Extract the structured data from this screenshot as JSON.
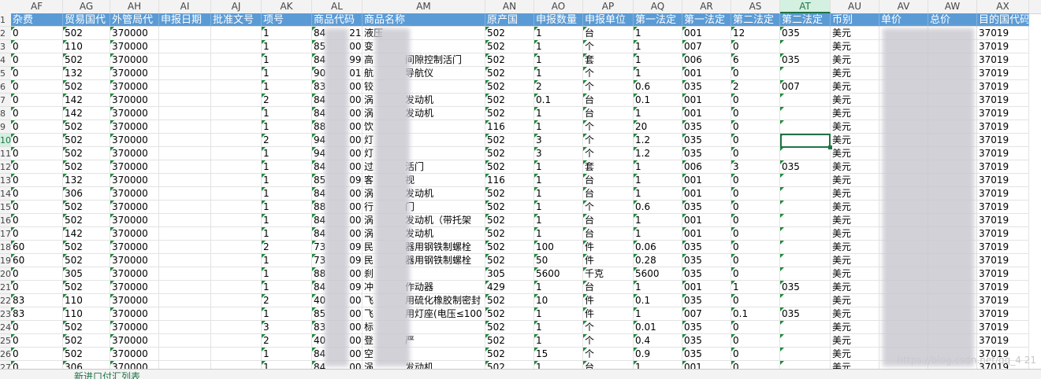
{
  "columns": [
    "AF",
    "AG",
    "AH",
    "AI",
    "AJ",
    "AK",
    "AL",
    "AM",
    "AN",
    "AO",
    "AP",
    "AQ",
    "AR",
    "AS",
    "AT",
    "AU",
    "AV",
    "AW",
    "AX"
  ],
  "active_column": "AT",
  "row_numbers": [
    "1",
    "2",
    "3",
    "4",
    "5",
    "6",
    "7",
    "8",
    "9",
    "10",
    "11",
    "12",
    "13",
    "14",
    "15",
    "16",
    "17",
    "18",
    "19",
    "20",
    "21",
    "22",
    "23",
    "24",
    "25",
    "26",
    "27"
  ],
  "active_row": "10",
  "headers": [
    "杂费",
    "贸易国代",
    "外管局代",
    "申报日期",
    "批准文号",
    "项号",
    "商品代码",
    "商品名称",
    "原产国",
    "申报数量",
    "申报单位",
    "第一法定",
    "第一法定",
    "第二法定",
    "第二法定",
    "币别",
    "单价",
    "总价",
    "目的国代码"
  ],
  "rows": [
    [
      "0",
      "502",
      "370000",
      "",
      "",
      "1",
      "84",
      "219",
      "液压",
      "",
      "502",
      "1",
      "台",
      "1",
      "001",
      "12",
      "035",
      "美元",
      "37019"
    ],
    [
      "0",
      "110",
      "370000",
      "",
      "",
      "1",
      "85",
      "00",
      "变",
      "",
      "502",
      "1",
      "个",
      "1",
      "007",
      "0",
      "",
      "美元",
      "37019"
    ],
    [
      "0",
      "502",
      "370000",
      "",
      "",
      "1",
      "84",
      "99",
      "高",
      "间隙控制活门",
      "502",
      "1",
      "套",
      "1",
      "006",
      "6",
      "035",
      "美元",
      "37019"
    ],
    [
      "0",
      "132",
      "370000",
      "",
      "",
      "1",
      "90",
      "01",
      "航",
      "导航仪",
      "502",
      "1",
      "个",
      "1",
      "001",
      "0",
      "",
      "美元",
      "37019"
    ],
    [
      "0",
      "502",
      "370000",
      "",
      "",
      "1",
      "83",
      "00",
      "铰",
      "",
      "502",
      "2",
      "个",
      "0.6",
      "035",
      "2",
      "007",
      "美元",
      "37019"
    ],
    [
      "0",
      "142",
      "370000",
      "",
      "",
      "2",
      "84",
      "00",
      "涡",
      "发动机",
      "502",
      "0.1",
      "台",
      "0.1",
      "001",
      "0",
      "",
      "美元",
      "37019"
    ],
    [
      "0",
      "142",
      "370000",
      "",
      "",
      "1",
      "84",
      "00",
      "涡",
      "发动机",
      "502",
      "1",
      "台",
      "1",
      "001",
      "0",
      "",
      "美元",
      "37019"
    ],
    [
      "0",
      "502",
      "370000",
      "",
      "",
      "1",
      "88",
      "00",
      "饮",
      "",
      "116",
      "1",
      "个",
      "20",
      "035",
      "0",
      "",
      "美元",
      "37019"
    ],
    [
      "0",
      "502",
      "370000",
      "",
      "",
      "2",
      "94",
      "00",
      "灯",
      "",
      "502",
      "3",
      "个",
      "1.2",
      "035",
      "0",
      "",
      "美元",
      "37019"
    ],
    [
      "0",
      "502",
      "370000",
      "",
      "",
      "1",
      "94",
      "00",
      "灯",
      "",
      "502",
      "3",
      "个",
      "1.2",
      "035",
      "0",
      "",
      "美元",
      "37019"
    ],
    [
      "0",
      "502",
      "370000",
      "",
      "",
      "1",
      "84",
      "00",
      "过",
      "活门",
      "502",
      "1",
      "套",
      "1",
      "006",
      "3",
      "035",
      "美元",
      "37019"
    ],
    [
      "0",
      "132",
      "370000",
      "",
      "",
      "1",
      "85",
      "09",
      "客",
      "视",
      "116",
      "1",
      "台",
      "1",
      "001",
      "0",
      "",
      "美元",
      "37019"
    ],
    [
      "0",
      "306",
      "370000",
      "",
      "",
      "1",
      "84",
      "00",
      "涡",
      "发动机",
      "502",
      "1",
      "台",
      "1",
      "001",
      "0",
      "",
      "美元",
      "37019"
    ],
    [
      "0",
      "502",
      "370000",
      "",
      "",
      "1",
      "88",
      "00",
      "行",
      "门",
      "502",
      "1",
      "个",
      "0.6",
      "035",
      "0",
      "",
      "美元",
      "37019"
    ],
    [
      "0",
      "502",
      "370000",
      "",
      "",
      "1",
      "84",
      "00",
      "涡",
      "发动机（带托架",
      "502",
      "1",
      "台",
      "1",
      "001",
      "0",
      "",
      "美元",
      "37019"
    ],
    [
      "0",
      "142",
      "370000",
      "",
      "",
      "1",
      "84",
      "00",
      "涡",
      "发动机",
      "502",
      "1",
      "台",
      "1",
      "001",
      "0",
      "",
      "美元",
      "37019"
    ],
    [
      "60",
      "502",
      "370000",
      "",
      "",
      "2",
      "73",
      "09",
      "民",
      "器用钢铁制螺栓",
      "502",
      "100",
      "件",
      "0.06",
      "035",
      "0",
      "",
      "美元",
      "37019"
    ],
    [
      "60",
      "502",
      "370000",
      "",
      "",
      "1",
      "73",
      "09",
      "民",
      "器用钢铁制螺栓",
      "502",
      "50",
      "件",
      "0.28",
      "035",
      "0",
      "",
      "美元",
      "37019"
    ],
    [
      "0",
      "305",
      "370000",
      "",
      "",
      "1",
      "88",
      "00",
      "刹",
      "",
      "305",
      "5600",
      "千克",
      "5600",
      "035",
      "0",
      "",
      "美元",
      "37019"
    ],
    [
      "0",
      "502",
      "370000",
      "",
      "",
      "1",
      "84",
      "09",
      "冲",
      "作动器",
      "429",
      "1",
      "台",
      "1",
      "001",
      "1",
      "035",
      "美元",
      "37019"
    ],
    [
      "83",
      "110",
      "370000",
      "",
      "",
      "2",
      "40",
      "00",
      "飞",
      "用硫化橡胶制密封",
      "502",
      "10",
      "件",
      "0.1",
      "035",
      "0",
      "",
      "美元",
      "37019"
    ],
    [
      "83",
      "110",
      "370000",
      "",
      "",
      "1",
      "85",
      "00",
      "飞",
      "用灯座(电压≤100",
      "502",
      "1",
      "件",
      "1",
      "007",
      "0.1",
      "035",
      "美元",
      "37019"
    ],
    [
      "0",
      "502",
      "370000",
      "",
      "",
      "3",
      "83",
      "00",
      "标",
      "",
      "502",
      "1",
      "个",
      "0.01",
      "035",
      "0",
      "",
      "美元",
      "37019"
    ],
    [
      "0",
      "502",
      "370000",
      "",
      "",
      "2",
      "40",
      "00",
      "登",
      "严",
      "502",
      "1",
      "个",
      "0.4",
      "035",
      "0",
      "",
      "美元",
      "37019"
    ],
    [
      "0",
      "502",
      "370000",
      "",
      "",
      "1",
      "84",
      "00",
      "空",
      "",
      "502",
      "15",
      "个",
      "0.9",
      "035",
      "0",
      "",
      "美元",
      "37019"
    ],
    [
      "0",
      "306",
      "370000",
      "",
      "",
      "1",
      "84",
      "00",
      "涡",
      "发动机",
      "502",
      "1",
      "台",
      "1",
      "001",
      "0",
      "",
      "美元",
      "37019"
    ]
  ],
  "sheet_tab": "新进口付汇列表",
  "watermark": "https://blog.csdn.net/qq_4  21"
}
